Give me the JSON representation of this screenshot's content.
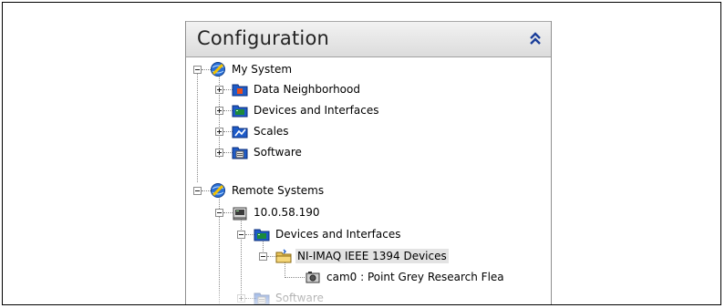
{
  "panel": {
    "title": "Configuration",
    "collapse_icon": "double-chevron-up-icon"
  },
  "tree": {
    "my_system": {
      "label": "My System",
      "icon": "system-globe-icon",
      "children": [
        {
          "label": "Data Neighborhood",
          "icon": "data-neighborhood-icon"
        },
        {
          "label": "Devices and Interfaces",
          "icon": "devices-icon"
        },
        {
          "label": "Scales",
          "icon": "scales-icon"
        },
        {
          "label": "Software",
          "icon": "software-icon"
        }
      ]
    },
    "remote_systems": {
      "label": "Remote Systems",
      "icon": "system-globe-icon",
      "host": {
        "label": "10.0.58.190",
        "icon": "computer-icon",
        "devices": {
          "label": "Devices and Interfaces",
          "icon": "devices-icon",
          "imaq": {
            "label": "NI-IMAQ IEEE 1394 Devices",
            "icon": "folder-icon",
            "camera": {
              "label": "cam0 : Point Grey Research Flea",
              "icon": "camera-icon"
            }
          }
        },
        "software": {
          "label": "Software",
          "icon": "software-icon"
        }
      }
    }
  },
  "colors": {
    "header_bg": "#e6e6e6",
    "selection_bg": "#e3e3e3",
    "folder_blue": "#1e5bc8",
    "device_green": "#1b8a3a"
  }
}
